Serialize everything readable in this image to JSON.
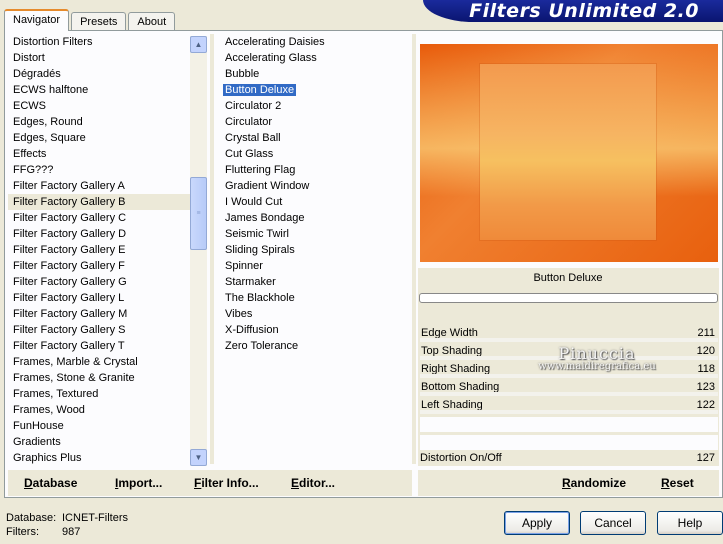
{
  "app": {
    "title": "Filters Unlimited 2.0"
  },
  "tabs": [
    {
      "label": "Navigator",
      "active": true
    },
    {
      "label": "Presets",
      "active": false
    },
    {
      "label": "About",
      "active": false
    }
  ],
  "categories": [
    "Distortion Filters",
    "Distort",
    "Dégradés",
    "ECWS halftone",
    "ECWS",
    "Edges, Round",
    "Edges, Square",
    "Effects",
    "FFG???",
    "Filter Factory Gallery A",
    "Filter Factory Gallery B",
    "Filter Factory Gallery C",
    "Filter Factory Gallery D",
    "Filter Factory Gallery E",
    "Filter Factory Gallery F",
    "Filter Factory Gallery G",
    "Filter Factory Gallery L",
    "Filter Factory Gallery M",
    "Filter Factory Gallery S",
    "Filter Factory Gallery T",
    "Frames, Marble & Crystal",
    "Frames, Stone & Granite",
    "Frames, Textured",
    "Frames, Wood",
    "FunHouse",
    "Gradients",
    "Graphics Plus"
  ],
  "selected_category": "Filter Factory Gallery B",
  "filters": [
    "Accelerating Daisies",
    "Accelerating Glass",
    "Bubble",
    "Button Deluxe",
    "Circulator 2",
    "Circulator",
    "Crystal Ball",
    "Cut Glass",
    "Fluttering Flag",
    "Gradient Window",
    "I Would Cut",
    "James Bondage",
    "Seismic Twirl",
    "Sliding Spirals",
    "Spinner",
    "Starmaker",
    "The Blackhole",
    "Vibes",
    "X-Diffusion",
    "Zero Tolerance"
  ],
  "selected_filter": "Button Deluxe",
  "preview": {
    "filter_name": "Button Deluxe",
    "progress": 0
  },
  "params": [
    {
      "label": "Edge Width",
      "value": "211"
    },
    {
      "label": "Top Shading",
      "value": "120"
    },
    {
      "label": "Right Shading",
      "value": "118"
    },
    {
      "label": "Bottom Shading",
      "value": "123"
    },
    {
      "label": "Left Shading",
      "value": "122"
    }
  ],
  "param_distortion": {
    "label": "Distortion On/Off",
    "value": "127"
  },
  "watermark": {
    "line1": "Pinuccia",
    "line2": "www.maidiregrafica.eu"
  },
  "bottom_links": {
    "database": "Database",
    "import": "Import...",
    "filter_info": "Filter Info...",
    "editor": "Editor...",
    "randomize": "Randomize",
    "reset": "Reset"
  },
  "status": {
    "database_label": "Database:",
    "database_value": "ICNET-Filters",
    "filters_label": "Filters:",
    "filters_value": "987"
  },
  "buttons": {
    "apply": "Apply",
    "cancel": "Cancel",
    "help": "Help"
  },
  "colors": {
    "selection": "#316ac5",
    "banner": "#0a1570",
    "preview_orange": "#e85a0a"
  }
}
